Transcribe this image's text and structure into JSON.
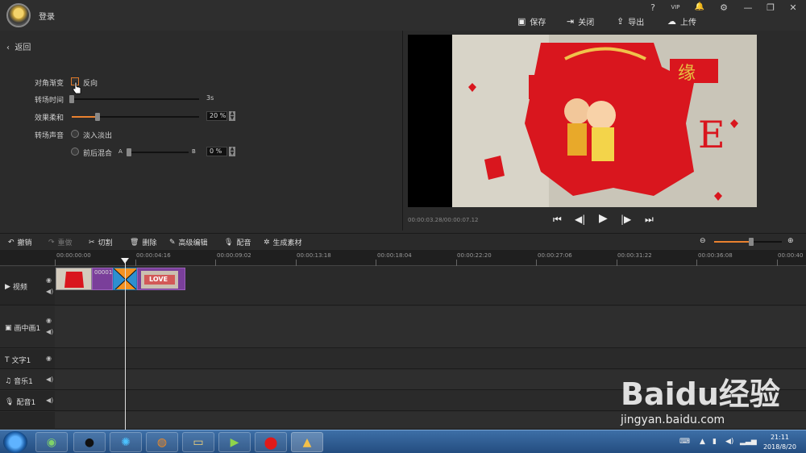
{
  "titlebar": {
    "login": "登录",
    "window_controls": [
      "?",
      "VIP",
      "🔔",
      "⚙",
      "—",
      "❐",
      "✕"
    ],
    "actions": [
      {
        "icon": "save-icon",
        "label": "保存"
      },
      {
        "icon": "close-file-icon",
        "label": "关闭"
      },
      {
        "icon": "export-icon",
        "label": "导出"
      },
      {
        "icon": "upload-icon",
        "label": "上传"
      }
    ]
  },
  "panel": {
    "back": "返回",
    "diagonal_label": "对角渐变",
    "reverse_label": "反向",
    "duration_label": "转场时间",
    "duration_value": "3s",
    "duration_level": 0.0,
    "softness_label": "效果柔和",
    "softness_value": "20 %",
    "softness_level": 0.2,
    "sound_label": "转场声音",
    "fade_label": "淡入淡出",
    "mix_label": "前后混合",
    "mix_a": "A",
    "mix_b": "B",
    "mix_value": "0 %",
    "mix_level": 0.0
  },
  "player": {
    "timecode": "00:00:03.28/00:00:07.12",
    "controls": [
      "skip-start-icon",
      "prev-frame-icon",
      "play-icon",
      "next-frame-icon",
      "skip-end-icon"
    ]
  },
  "edit_toolbar": {
    "undo": "撤销",
    "redo": "重做",
    "cut": "切割",
    "delete": "删除",
    "advanced": "高级编辑",
    "dub": "配音",
    "generate": "生成素材",
    "zoom_level": 0.55
  },
  "ruler": [
    "00:00:00:00",
    "00:00:04:16",
    "00:00:09:02",
    "00:00:13:18",
    "00:00:18:04",
    "00:00:22:20",
    "00:00:27:06",
    "00:00:31:22",
    "00:00:36:08",
    "00:00:40"
  ],
  "tracks": {
    "video": "视频",
    "pip": "画中画1",
    "text": "文字1",
    "music": "音乐1",
    "voice": "配音1"
  },
  "clips": {
    "clip1_label": "00001",
    "clip2_label": "LOVE"
  },
  "taskbar": {
    "time": "21:11",
    "date": "2018/8/20"
  },
  "watermark": {
    "brand": "Baidu经验",
    "url": "jingyan.baidu.com"
  }
}
